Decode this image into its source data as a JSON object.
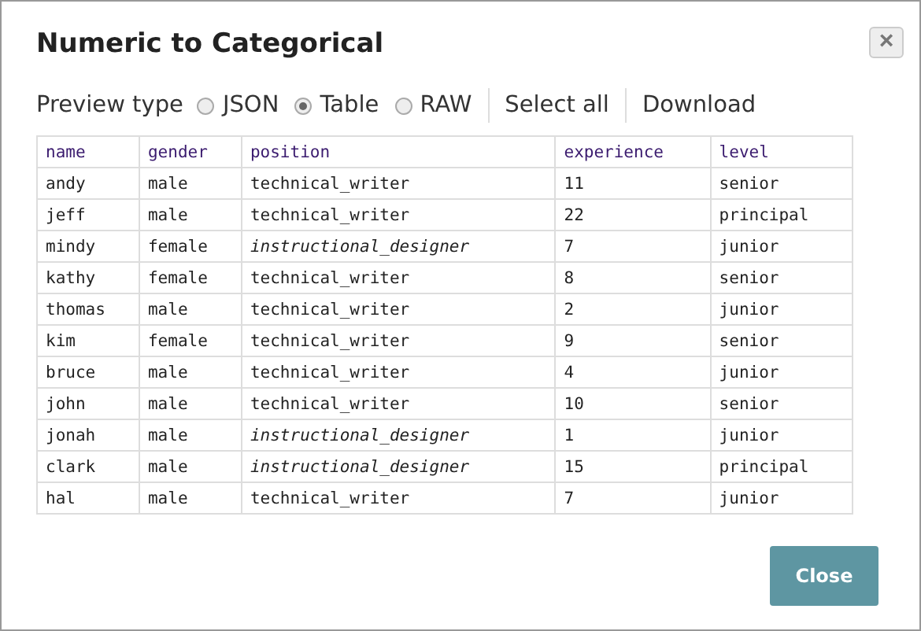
{
  "dialog": {
    "title": "Numeric to Categorical",
    "close_icon": "×"
  },
  "toolbar": {
    "label": "Preview type",
    "options": [
      {
        "label": "JSON",
        "selected": false
      },
      {
        "label": "Table",
        "selected": true
      },
      {
        "label": "RAW",
        "selected": false
      }
    ],
    "links": [
      "Select all",
      "Download"
    ]
  },
  "table": {
    "columns": [
      "name",
      "gender",
      "position",
      "experience",
      "level"
    ],
    "rows": [
      [
        {
          "text": "andy",
          "italic": false
        },
        {
          "text": "male",
          "italic": false
        },
        {
          "text": "technical_writer",
          "italic": false
        },
        {
          "text": "11",
          "italic": false
        },
        {
          "text": "senior",
          "italic": false
        }
      ],
      [
        {
          "text": "jeff",
          "italic": false
        },
        {
          "text": "male",
          "italic": false
        },
        {
          "text": "technical_writer",
          "italic": false
        },
        {
          "text": "22",
          "italic": false
        },
        {
          "text": "principal",
          "italic": false
        }
      ],
      [
        {
          "text": "mindy",
          "italic": false
        },
        {
          "text": "female",
          "italic": false
        },
        {
          "text": "instructional_designer",
          "italic": true
        },
        {
          "text": "7",
          "italic": false
        },
        {
          "text": "junior",
          "italic": false
        }
      ],
      [
        {
          "text": "kathy",
          "italic": false
        },
        {
          "text": "female",
          "italic": false
        },
        {
          "text": "technical_writer",
          "italic": false
        },
        {
          "text": "8",
          "italic": false
        },
        {
          "text": "senior",
          "italic": false
        }
      ],
      [
        {
          "text": "thomas",
          "italic": false
        },
        {
          "text": "male",
          "italic": false
        },
        {
          "text": "technical_writer",
          "italic": false
        },
        {
          "text": "2",
          "italic": false
        },
        {
          "text": "junior",
          "italic": false
        }
      ],
      [
        {
          "text": "kim",
          "italic": false
        },
        {
          "text": "female",
          "italic": false
        },
        {
          "text": "technical_writer",
          "italic": false
        },
        {
          "text": "9",
          "italic": false
        },
        {
          "text": "senior",
          "italic": false
        }
      ],
      [
        {
          "text": "bruce",
          "italic": false
        },
        {
          "text": "male",
          "italic": false
        },
        {
          "text": "technical_writer",
          "italic": false
        },
        {
          "text": "4",
          "italic": false
        },
        {
          "text": "junior",
          "italic": false
        }
      ],
      [
        {
          "text": "john",
          "italic": false
        },
        {
          "text": "male",
          "italic": false
        },
        {
          "text": "technical_writer",
          "italic": false
        },
        {
          "text": "10",
          "italic": false
        },
        {
          "text": "senior",
          "italic": false
        }
      ],
      [
        {
          "text": "jonah",
          "italic": false
        },
        {
          "text": "male",
          "italic": false
        },
        {
          "text": "instructional_designer",
          "italic": true
        },
        {
          "text": "1",
          "italic": false
        },
        {
          "text": "junior",
          "italic": false
        }
      ],
      [
        {
          "text": "clark",
          "italic": false
        },
        {
          "text": "male",
          "italic": false
        },
        {
          "text": "instructional_designer",
          "italic": true
        },
        {
          "text": "15",
          "italic": false
        },
        {
          "text": "principal",
          "italic": false
        }
      ],
      [
        {
          "text": "hal",
          "italic": false
        },
        {
          "text": "male",
          "italic": false
        },
        {
          "text": "technical_writer",
          "italic": false
        },
        {
          "text": "7",
          "italic": false
        },
        {
          "text": "junior",
          "italic": false
        }
      ]
    ]
  },
  "buttons": [
    "Close"
  ]
}
